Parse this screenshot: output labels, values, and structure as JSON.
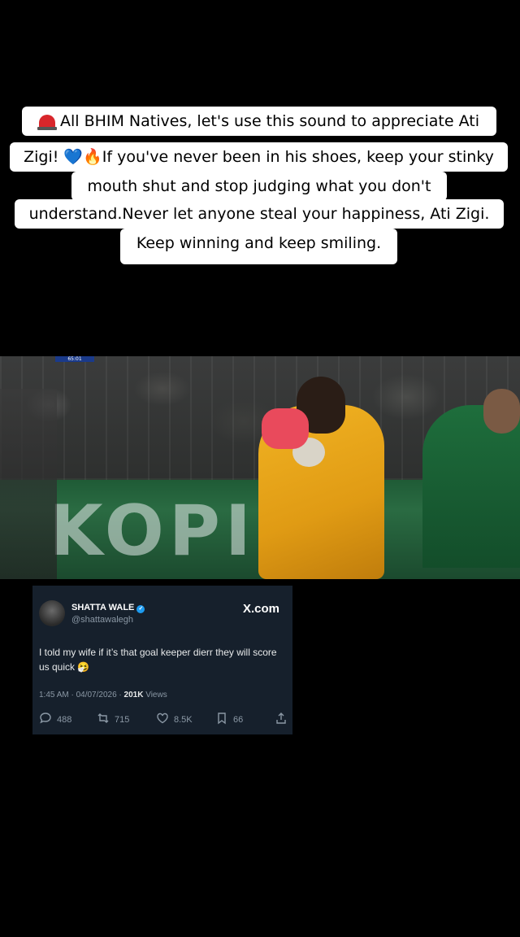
{
  "caption": {
    "line1": "All BHIM Natives, let's use this sound to appreciate Ati",
    "line2_a": "Zigi! ",
    "line2_heart": "💙",
    "line2_fire": "🔥",
    "line2_b": "If you've never been in his shoes, keep your stinky",
    "line3": "mouth shut and stop judging what you don't",
    "line4": "understand.Never let anyone steal your happiness, Ati Zigi.",
    "line5": "Keep winning and keep smiling.",
    "siren_icon": "police-light-icon"
  },
  "video": {
    "score_tag": "65:01",
    "board_text": "KOPI"
  },
  "tweet": {
    "name": "SHATTA WALE",
    "verified_mark": "✓",
    "handle": "@shattawalegh",
    "brand": "X.com",
    "text": "I told my wife if it’s that goal keeper dierr they will score us quick 🤧",
    "time": "1:45 AM · 04/07/2026 · ",
    "views_count": "201K",
    "views_label": " Views",
    "replies": "488",
    "reposts": "715",
    "likes": "8.5K",
    "bookmarks": "66",
    "colors": {
      "card_bg": "#16202c",
      "verified": "#1d9bf0",
      "muted": "#8b98a5"
    }
  }
}
